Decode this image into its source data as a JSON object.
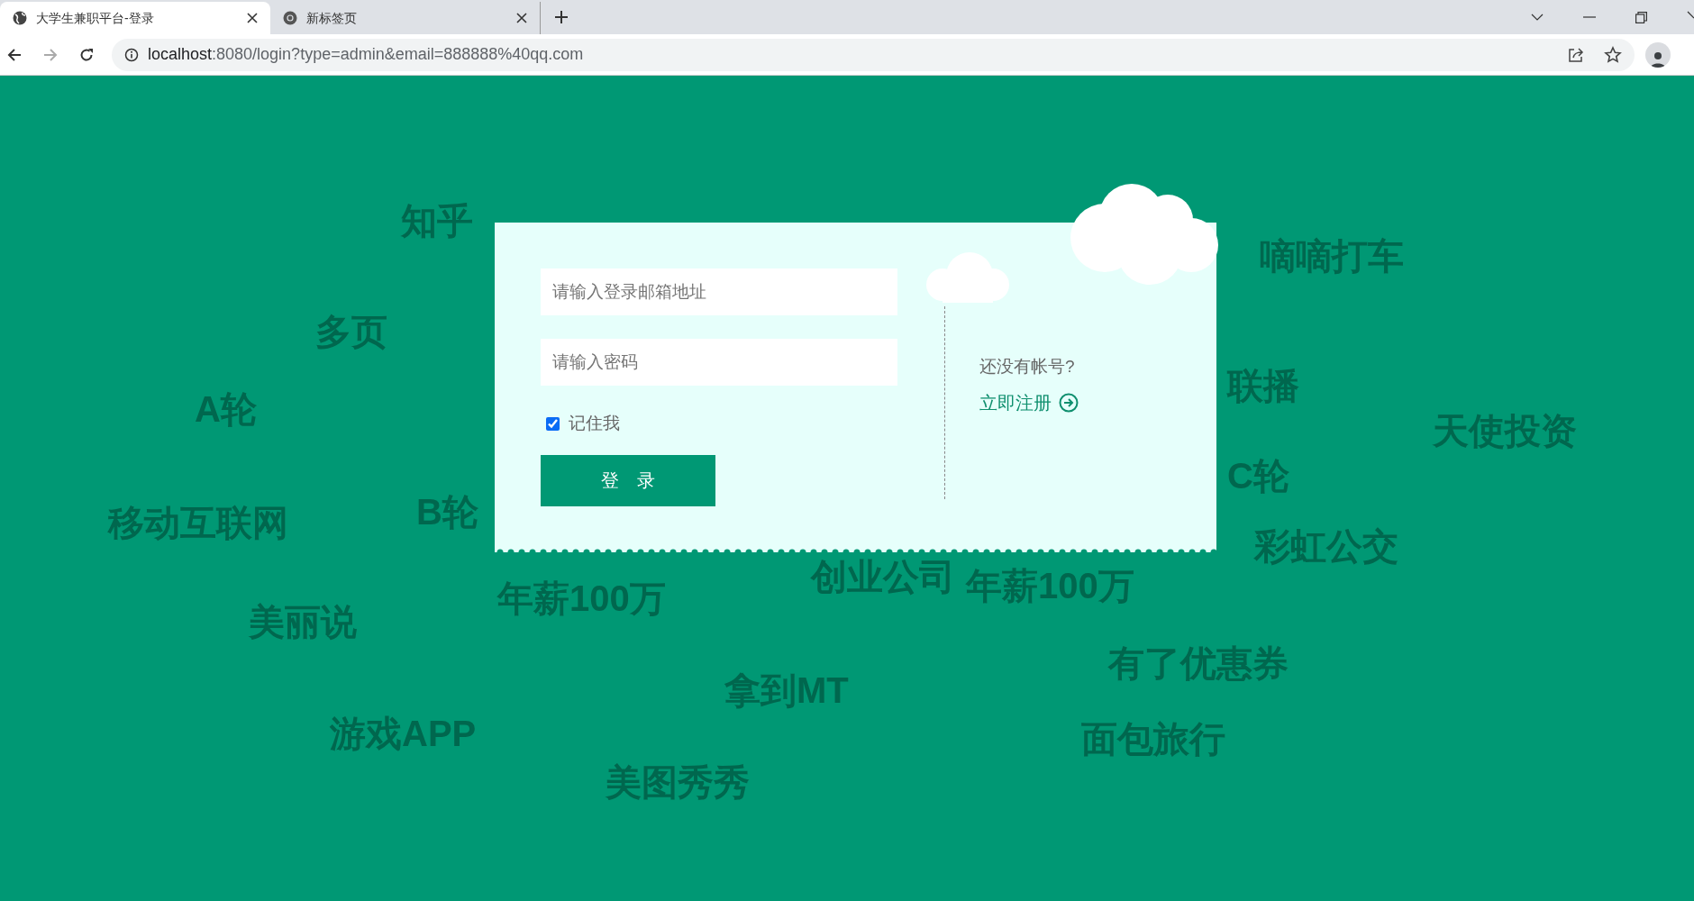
{
  "browser": {
    "tabs": [
      {
        "title": "大学生兼职平台-登录",
        "selected": true
      },
      {
        "title": "新标签页",
        "selected": false
      }
    ],
    "url": {
      "host": "localhost",
      "rest": ":8080/login?type=admin&email=888888%40qq.com"
    }
  },
  "background_words": [
    {
      "text": "知乎"
    },
    {
      "text": "多页"
    },
    {
      "text": "A轮"
    },
    {
      "text": "移动互联网"
    },
    {
      "text": "美丽说"
    },
    {
      "text": "游戏APP"
    },
    {
      "text": "年薪100万"
    },
    {
      "text": "创业公司"
    },
    {
      "text": "年薪100万"
    },
    {
      "text": "拿到MT"
    },
    {
      "text": "美图秀秀"
    },
    {
      "text": "有了优惠券"
    },
    {
      "text": "面包旅行"
    },
    {
      "text": "嘀嘀打车"
    },
    {
      "text": "天使投资"
    },
    {
      "text": "彩虹公交"
    },
    {
      "text": "联播"
    },
    {
      "text": "C轮"
    },
    {
      "text": "B轮"
    }
  ],
  "login": {
    "email": {
      "placeholder": "请输入登录邮箱地址"
    },
    "password": {
      "placeholder": "请输入密码"
    },
    "remember": {
      "label": "记住我",
      "checked": true
    },
    "submit": "登　录",
    "register_prompt": "还没有帐号?",
    "register_link": "立即注册"
  }
}
